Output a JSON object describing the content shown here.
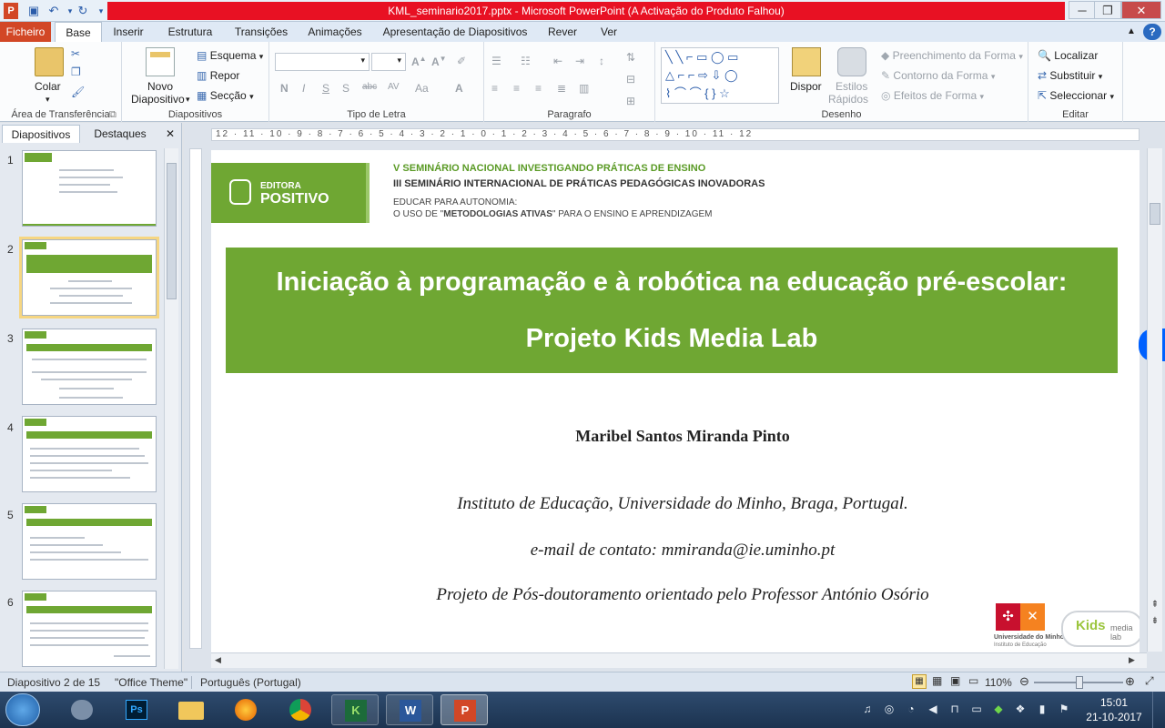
{
  "window": {
    "title": "KML_seminario2017.pptx  -  Microsoft PowerPoint (A Activação do Produto Falhou)"
  },
  "ribbon": {
    "tabs": [
      "Ficheiro",
      "Base",
      "Inserir",
      "Estrutura",
      "Transições",
      "Animações",
      "Apresentação de Diapositivos",
      "Rever",
      "Ver"
    ],
    "active_tab": "Base",
    "clipboard": {
      "paste": "Colar",
      "group": "Área de Transferência"
    },
    "slides": {
      "new_slide": "Novo",
      "new_slide2": "Diapositivo",
      "layout": "Esquema",
      "reset": "Repor",
      "section": "Secção",
      "group": "Diapositivos"
    },
    "font": {
      "bold": "N",
      "italic": "I",
      "underline": "S",
      "strike": "abc",
      "spacing": "AV",
      "case": "Aa",
      "group": "Tipo de Letra"
    },
    "paragraph": {
      "group": "Paragrafo"
    },
    "drawing": {
      "arrange": "Dispor",
      "quick_styles": "Estilos",
      "quick_styles2": "Rápidos",
      "fill": "Preenchimento da Forma",
      "outline": "Contorno da Forma",
      "effects": "Efeitos de Forma",
      "group": "Desenho"
    },
    "editing": {
      "find": "Localizar",
      "replace": "Substituir",
      "select": "Seleccionar",
      "group": "Editar"
    }
  },
  "panel": {
    "tabs": [
      "Diapositivos",
      "Destaques"
    ],
    "close": "✕",
    "slide_numbers": [
      "1",
      "2",
      "3",
      "4",
      "5",
      "6"
    ]
  },
  "ruler": {
    "h": "12 · 11 · 10 · 9 · 8 · 7 · 6 · 5 · 4 · 3 · 2 · 1 · 0 · 1 · 2 · 3 · 4 · 5 · 6 · 7 · 8 · 9 · 10 · 11 · 12"
  },
  "slide": {
    "logo_text1": "EDITORA",
    "logo_text2": "POSITIVO",
    "header_line1": "V SEMINÁRIO NACIONAL INVESTIGANDO PRÁTICAS DE ENSINO",
    "header_line2": "III SEMINÁRIO INTERNACIONAL DE PRÁTICAS PEDAGÓGICAS INOVADORAS",
    "header_line3": "EDUCAR PARA AUTONOMIA:",
    "header_line4a": "O USO DE \"",
    "header_line4b": "METODOLOGIAS ATIVAS",
    "header_line4c": "\" PARA O ENSINO E APRENDIZAGEM",
    "title_line1": "Iniciação à programação e à robótica na educação pré-escolar:",
    "title_line2": "Projeto Kids Media Lab",
    "author": "Maribel Santos Miranda Pinto",
    "institution": "Instituto de Educação, Universidade do Minho, Braga, Portugal.",
    "email": "e-mail de contato: mmiranda@ie.uminho.pt",
    "project": "Projeto de Pós-doutoramento orientado pelo Professor António Osório",
    "uminho_label": "Universidade do Minho",
    "uminho_sub": "Instituto de Educação",
    "kids_label": "Kids",
    "kids_sub": "media lab"
  },
  "status": {
    "slide_info": "Diapositivo 2 de 15",
    "theme": "\"Office Theme\"",
    "language": "Português (Portugal)",
    "zoom": "110%"
  },
  "clock": {
    "time": "15:01",
    "date": "21-10-2017"
  },
  "colors": {
    "accent_green": "#6fa733",
    "title_red": "#e81123",
    "file_tab": "#d24726"
  }
}
